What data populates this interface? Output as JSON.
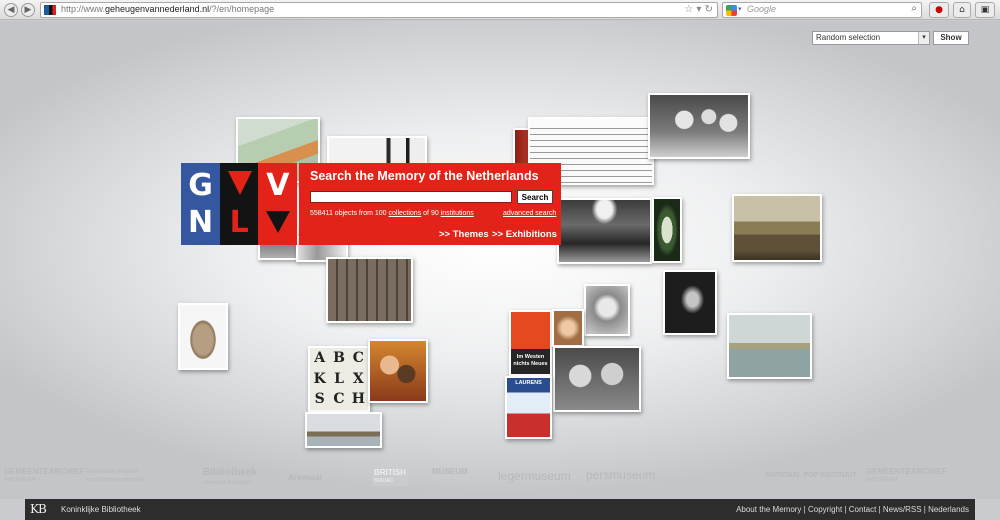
{
  "browser": {
    "url_prefix": "http://www.",
    "url_domain": "geheugenvannederland.nl",
    "url_path": "/?/en/homepage",
    "search_placeholder": "Google"
  },
  "selector": {
    "selected": "Random selection",
    "show_label": "Show"
  },
  "logo": {
    "letters": [
      "G",
      "V",
      "V",
      "N",
      "L",
      "V"
    ]
  },
  "search_panel": {
    "title": "Search the Memory of the Netherlands",
    "button": "Search",
    "stats": {
      "objects": "558411",
      "objects_text": "objects from",
      "collections_count": "100",
      "collections_label": "collections",
      "of_text": "of",
      "institutions_count": "90",
      "institutions_label": "institutions"
    },
    "advanced_label": "advanced search",
    "themes_label": ">> Themes",
    "exhibitions_label": ">> Exhibitions"
  },
  "photo_texts": {
    "poster_1_line1": "Im Westen",
    "poster_1_line2": "nichts Neues",
    "poster_2": "LAURENS",
    "letters": [
      "A",
      "B",
      "C",
      "K",
      "L",
      "X",
      "S",
      "C",
      "H"
    ]
  },
  "partners": [
    {
      "line1": "GEMEENTEARCHIEF",
      "line2": "AMSTERDAM"
    },
    {
      "line1": "Nederlands Instituut",
      "line2": "voor Oorlogsdocumentatie"
    },
    {
      "line1": "Bibliotheek",
      "line2": "Gemeente Rotterdam"
    },
    {
      "line1": "Arsenaal",
      "line2": ""
    },
    {
      "line1": "BRITISH",
      "line2": "BRIDAD"
    },
    {
      "line1": "MUSEUM",
      "line2": ""
    },
    {
      "line1": "legermuseum",
      "line2": ""
    },
    {
      "line1": "persmuseum",
      "line2": ""
    },
    {
      "line1": "NATIONAL POP INSTITUUT",
      "line2": ""
    },
    {
      "line1": "GEMEENTEARCHIEF",
      "line2": "AMSTERDAM"
    }
  ],
  "footer": {
    "kb_mark": "KB",
    "kb_name": "Koninklijke Bibliotheek",
    "links": [
      "About the Memory",
      "Copyright",
      "Contact",
      "News/RSS",
      "Nederlands"
    ]
  },
  "colors": {
    "brand_red": "#e3231a",
    "brand_blue": "#3457a0",
    "footer_bg": "#2d2d2d"
  }
}
